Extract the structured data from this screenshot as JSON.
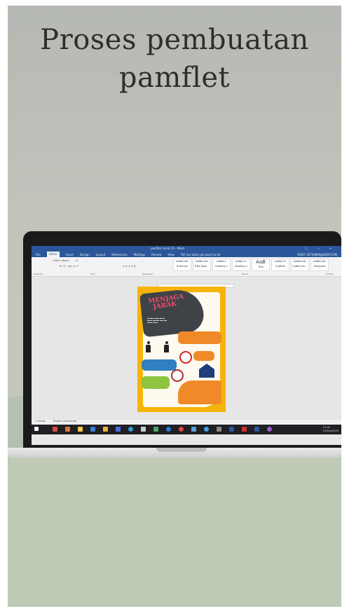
{
  "heading": {
    "line1": "Proses pembuatan",
    "line2": "pamflet"
  },
  "word": {
    "document_title": "pamflet covid 19 - Word",
    "tabs": [
      "File",
      "Home",
      "Insert",
      "Design",
      "Layout",
      "References",
      "Mailings",
      "Review",
      "View"
    ],
    "tell_me": "Tell me what you want to do",
    "user": "RIZKY SETIAWAN@IBOY.COM",
    "font_name": "Calibri (Body)",
    "font_size": "11",
    "styles": [
      "AaBbCcDc",
      "AaBbCcDc",
      "AaBbCc",
      "AaBbCcC",
      "AaB",
      "AaBbCcC",
      "AaBbCcDc",
      "AaBbCcDc"
    ],
    "style_names": [
      "¶ Normal",
      "¶ No Spac...",
      "Heading 1",
      "Heading 2",
      "Title",
      "Subtitle",
      "Subtle Em...",
      "Emphasis"
    ],
    "groups": [
      "Clipboard",
      "Font",
      "Paragraph",
      "Styles",
      "Editing"
    ],
    "status_words": "0 words",
    "status_lang": "English (Indonesia)",
    "clock_time": "21:16",
    "clock_date": "10/Sep/2020"
  },
  "pamphlet": {
    "title_line1": "MENJAGA",
    "title_line2": "JARAK"
  },
  "colors": {
    "word_blue": "#2b579a",
    "pamphlet_yellow": "#f6b40a",
    "pamphlet_pink": "#f04e6e"
  }
}
